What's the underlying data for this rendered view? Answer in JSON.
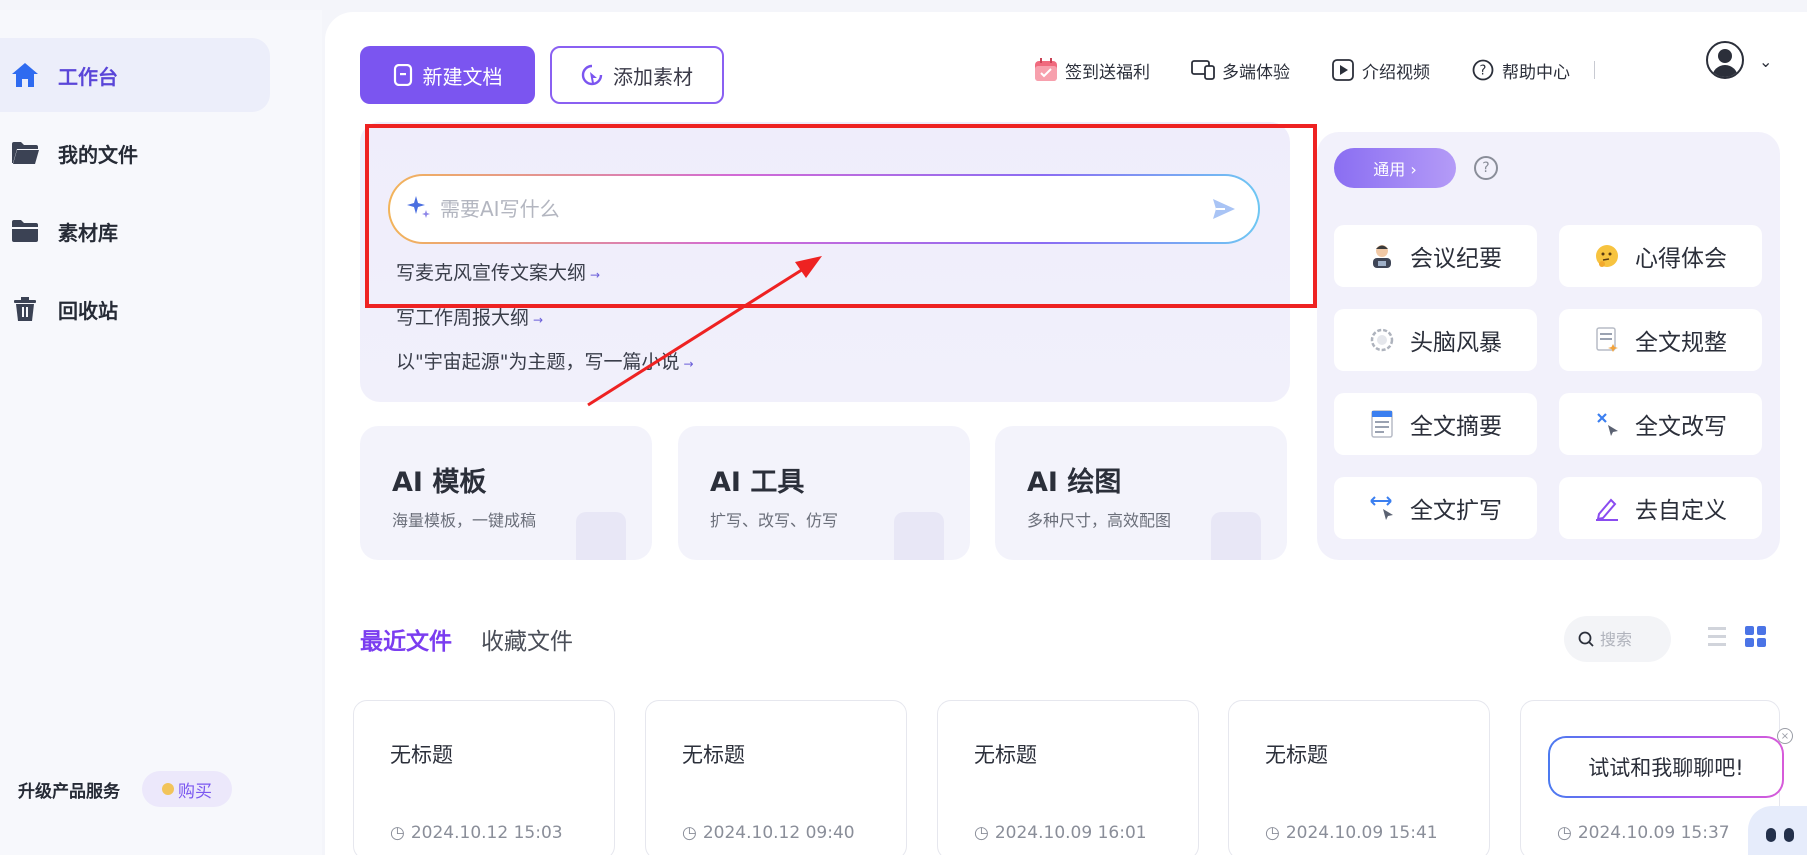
{
  "sidebar": {
    "items": [
      {
        "label": "工作台",
        "icon": "home-icon",
        "active": true
      },
      {
        "label": "我的文件",
        "icon": "folder-open-icon"
      },
      {
        "label": "素材库",
        "icon": "folder-icon"
      },
      {
        "label": "回收站",
        "icon": "trash-icon"
      }
    ],
    "upgrade_label": "升级产品服务",
    "buy_label": "购买"
  },
  "header": {
    "new_doc_label": "新建文档",
    "add_material_label": "添加素材",
    "actions": [
      {
        "label": "签到送福利",
        "icon": "calendar-gift-icon"
      },
      {
        "label": "多端体验",
        "icon": "devices-icon"
      },
      {
        "label": "介绍视频",
        "icon": "play-icon"
      },
      {
        "label": "帮助中心",
        "icon": "help-icon"
      }
    ]
  },
  "ai_write": {
    "placeholder": "需要AI写什么",
    "suggestions": [
      "写麦克风宣传文案大纲",
      "写工作周报大纲",
      "以\"宇宙起源\"为主题，写一篇小说"
    ]
  },
  "feature_cards": [
    {
      "title": "AI 模板",
      "subtitle": "海量模板，一键成稿"
    },
    {
      "title": "AI 工具",
      "subtitle": "扩写、改写、仿写"
    },
    {
      "title": "AI 绘图",
      "subtitle": "多种尺寸，高效配图"
    }
  ],
  "tools": {
    "category_label": "通用 ›",
    "items": [
      {
        "label": "会议纪要",
        "icon": "meeting-icon"
      },
      {
        "label": "心得体会",
        "icon": "thinking-face-icon"
      },
      {
        "label": "头脑风暴",
        "icon": "brainstorm-icon"
      },
      {
        "label": "全文规整",
        "icon": "format-doc-icon"
      },
      {
        "label": "全文摘要",
        "icon": "summary-doc-icon"
      },
      {
        "label": "全文改写",
        "icon": "rewrite-icon"
      },
      {
        "label": "全文扩写",
        "icon": "expand-icon"
      },
      {
        "label": "去自定义",
        "icon": "pencil-icon"
      }
    ]
  },
  "files_section": {
    "tab_recent": "最近文件",
    "tab_favorites": "收藏文件",
    "search_placeholder": "搜索",
    "files": [
      {
        "title": "无标题",
        "time": "2024.10.12 15:03"
      },
      {
        "title": "无标题",
        "time": "2024.10.12 09:40"
      },
      {
        "title": "无标题",
        "time": "2024.10.09 16:01"
      },
      {
        "title": "无标题",
        "time": "2024.10.09 15:41"
      },
      {
        "title": "",
        "time": "2024.10.09 15:37"
      }
    ]
  },
  "chat_bubble": {
    "text": "试试和我聊聊吧!"
  },
  "colors": {
    "brand_purple": "#7b55f0",
    "annotation_red": "#ee2222",
    "active_nav_text": "#5a46d8"
  }
}
